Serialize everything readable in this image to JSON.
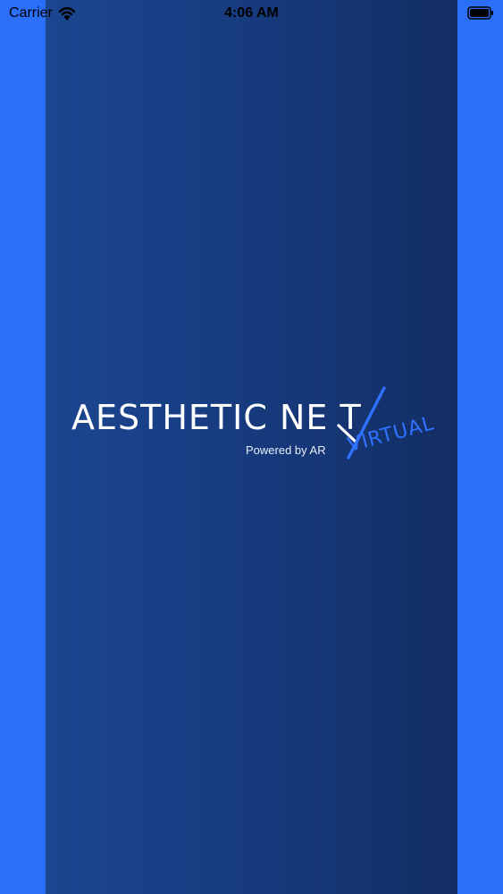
{
  "colors": {
    "outer_background": "#2b6ef7",
    "splash_gradient_start": "#1b4790",
    "splash_gradient_end": "#132d63",
    "logo_text": "#ffffff",
    "accent": "#2f72ff"
  },
  "status_bar": {
    "carrier": "Carrier",
    "time": "4:06 AM",
    "icons": {
      "wifi": "wifi-icon",
      "battery": "battery-icon"
    }
  },
  "logo": {
    "main_text": "AESTHETIC NE T",
    "powered_by": "Powered by AR",
    "virtual_text": "VIRTUAL",
    "icon": "brand-x-mark-icon"
  }
}
